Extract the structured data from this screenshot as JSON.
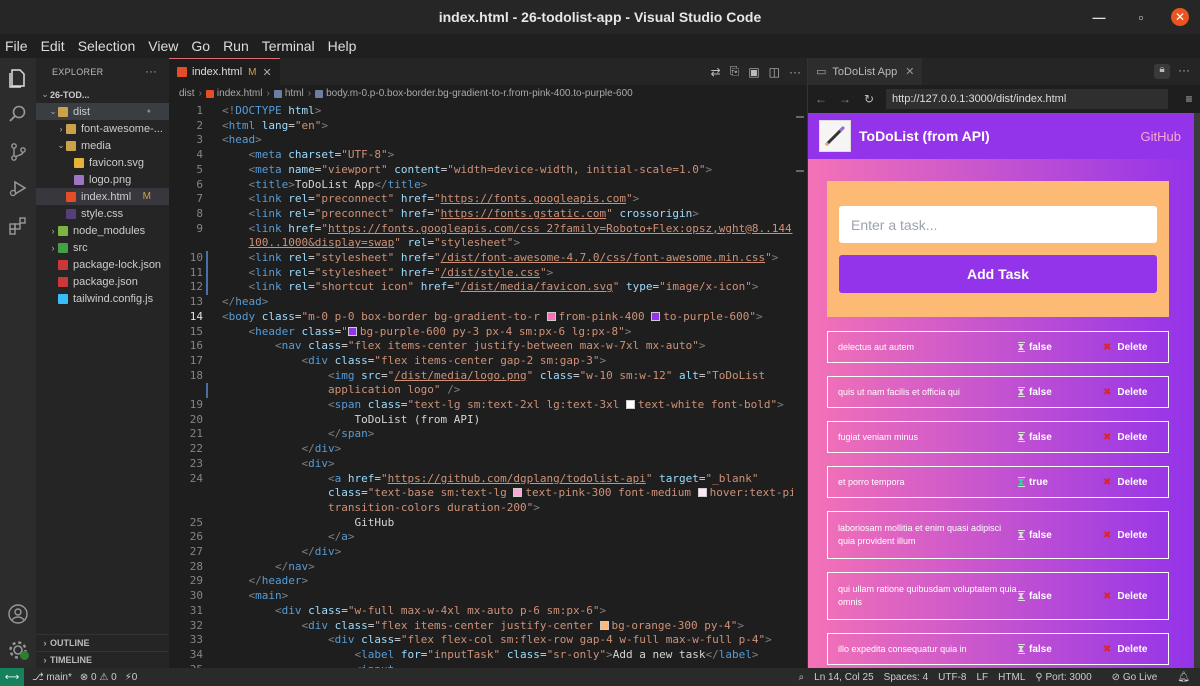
{
  "window": {
    "title": "index.html - 26-todolist-app - Visual Studio Code"
  },
  "menu": [
    "File",
    "Edit",
    "Selection",
    "View",
    "Go",
    "Run",
    "Terminal",
    "Help"
  ],
  "explorer": {
    "header": "EXPLORER",
    "tree": [
      {
        "label": "26-TOD...",
        "indent": 0,
        "chev": "⌄",
        "bold": true
      },
      {
        "label": "dist",
        "indent": 1,
        "chev": "⌄",
        "icon": "#c9a24a",
        "dot": "●",
        "open": true
      },
      {
        "label": "font-awesome-...",
        "indent": 2,
        "chev": "›",
        "icon": "#c9a24a"
      },
      {
        "label": "media",
        "indent": 2,
        "chev": "⌄",
        "icon": "#c9a24a"
      },
      {
        "label": "favicon.svg",
        "indent": 3,
        "icon": "#e8b339"
      },
      {
        "label": "logo.png",
        "indent": 3,
        "icon": "#a074c4"
      },
      {
        "label": "index.html",
        "indent": 2,
        "icon": "#e44d26",
        "badge": "M",
        "selected": true
      },
      {
        "label": "style.css",
        "indent": 2,
        "icon": "#563d7c"
      },
      {
        "label": "node_modules",
        "indent": 1,
        "chev": "›",
        "icon": "#7cb342"
      },
      {
        "label": "src",
        "indent": 1,
        "chev": "›",
        "icon": "#43a047"
      },
      {
        "label": "package-lock.json",
        "indent": 1,
        "icon": "#cb3837"
      },
      {
        "label": "package.json",
        "indent": 1,
        "icon": "#cb3837"
      },
      {
        "label": "tailwind.config.js",
        "indent": 1,
        "icon": "#38bdf8"
      }
    ],
    "outline": "OUTLINE",
    "timeline": "TIMELINE"
  },
  "editor": {
    "tab": {
      "label": "index.html",
      "badge": "M"
    },
    "breadcrumb": [
      "dist",
      "index.html",
      "html",
      "body.m-0.p-0.box-border.bg-gradient-to-r.from-pink-400.to-purple-600"
    ],
    "lines": [
      {
        "n": "1",
        "h": "<span class='p'>&lt;!</span><span class='t'>DOCTYPE</span> <span class='a'>html</span><span class='p'>&gt;</span>"
      },
      {
        "n": "2",
        "h": "<span class='p'>&lt;</span><span class='t'>html</span> <span class='a'>lang</span>=<span class='s'>\"en\"</span><span class='p'>&gt;</span>"
      },
      {
        "n": "3",
        "h": "<span class='p'>&lt;</span><span class='t'>head</span><span class='p'>&gt;</span>"
      },
      {
        "n": "4",
        "h": "    <span class='p'>&lt;</span><span class='t'>meta</span> <span class='a'>charset</span>=<span class='s'>\"UTF-8\"</span><span class='p'>&gt;</span>"
      },
      {
        "n": "5",
        "h": "    <span class='p'>&lt;</span><span class='t'>meta</span> <span class='a'>name</span>=<span class='s'>\"viewport\"</span> <span class='a'>content</span>=<span class='s'>\"width=device-width, initial-scale=1.0\"</span><span class='p'>&gt;</span>"
      },
      {
        "n": "6",
        "h": "    <span class='p'>&lt;</span><span class='t'>title</span><span class='p'>&gt;</span>ToDoList App<span class='p'>&lt;/</span><span class='t'>title</span><span class='p'>&gt;</span>"
      },
      {
        "n": "7",
        "h": "    <span class='p'>&lt;</span><span class='t'>link</span> <span class='a'>rel</span>=<span class='s'>\"preconnect\"</span> <span class='a'>href</span>=<span class='s'>\"<span class='u'>https://fonts.googleapis.com</span>\"</span><span class='p'>&gt;</span>"
      },
      {
        "n": "8",
        "h": "    <span class='p'>&lt;</span><span class='t'>link</span> <span class='a'>rel</span>=<span class='s'>\"preconnect\"</span> <span class='a'>href</span>=<span class='s'>\"<span class='u'>https://fonts.gstatic.com</span>\"</span> <span class='a'>crossorigin</span><span class='p'>&gt;</span>"
      },
      {
        "n": "9",
        "h": "    <span class='p'>&lt;</span><span class='t'>link</span> <span class='a'>href</span>=<span class='s'>\"<span class='u'>https://fonts.googleapis.com/css 2?family=Roboto+Flex:opsz,wght@8..144,</span></span>"
      },
      {
        "n": "",
        "h": "    <span class='s'><span class='u'>100..1000&amp;display=swap</span>\"</span> <span class='a'>rel</span>=<span class='s'>\"stylesheet\"</span><span class='p'>&gt;</span>"
      },
      {
        "n": "10",
        "h": "    <span class='p'>&lt;</span><span class='t'>link</span> <span class='a'>rel</span>=<span class='s'>\"stylesheet\"</span> <span class='a'>href</span>=<span class='s'>\"<span class='u'>/dist/font-awesome-4.7.0/css/font-awesome.min.css</span>\"</span><span class='p'>&gt;</span>"
      },
      {
        "n": "11",
        "h": "    <span class='p'>&lt;</span><span class='t'>link</span> <span class='a'>rel</span>=<span class='s'>\"stylesheet\"</span> <span class='a'>href</span>=<span class='s'>\"<span class='u'>/dist/style.css</span>\"</span><span class='p'>&gt;</span>"
      },
      {
        "n": "12",
        "h": "    <span class='p'>&lt;</span><span class='t'>link</span> <span class='a'>rel</span>=<span class='s'>\"shortcut icon\"</span> <span class='a'>href</span>=<span class='s'>\"<span class='u'>/dist/media/favicon.svg</span>\"</span> <span class='a'>type</span>=<span class='s'>\"image/x-icon\"</span><span class='p'>&gt;</span>"
      },
      {
        "n": "13",
        "h": "<span class='p'>&lt;/</span><span class='t'>head</span><span class='p'>&gt;</span>"
      },
      {
        "n": "14",
        "h": "<span class='p'>&lt;</span><span class='t'>body</span> <span class='a'>class</span>=<span class='s'>\"m-0 p-0 box-border bg-gradient-to-r <span class='sw' style='background:#f472b6'></span>from-pink-400 <span class='sw' style='background:#9333ea'></span>to-purple-600\"</span><span class='p'>&gt;</span>",
        "cur": true
      },
      {
        "n": "15",
        "h": "    <span class='p'>&lt;</span><span class='t'>header</span> <span class='a'>class</span>=<span class='s'>\"<span class='sw' style='background:#9333ea'></span>bg-purple-600 py-3 px-4 sm:px-6 lg:px-8\"</span><span class='p'>&gt;</span>"
      },
      {
        "n": "16",
        "h": "        <span class='p'>&lt;</span><span class='t'>nav</span> <span class='a'>class</span>=<span class='s'>\"flex items-center justify-between max-w-7xl mx-auto\"</span><span class='p'>&gt;</span>"
      },
      {
        "n": "17",
        "h": "            <span class='p'>&lt;</span><span class='t'>div</span> <span class='a'>class</span>=<span class='s'>\"flex items-center gap-2 sm:gap-3\"</span><span class='p'>&gt;</span>"
      },
      {
        "n": "18",
        "h": "                <span class='p'>&lt;</span><span class='t'>img</span> <span class='a'>src</span>=<span class='s'>\"<span class='u'>/dist/media/logo.png</span>\"</span> <span class='a'>class</span>=<span class='s'>\"w-10 sm:w-12\"</span> <span class='a'>alt</span>=<span class='s'>\"ToDoList</span>"
      },
      {
        "n": "",
        "h": "                <span class='s'>application logo\"</span> <span class='p'>/&gt;</span>"
      },
      {
        "n": "19",
        "h": "                <span class='p'>&lt;</span><span class='t'>span</span> <span class='a'>class</span>=<span class='s'>\"text-lg sm:text-2xl lg:text-3xl <span class='sw' style='background:#ffffff'></span>text-white font-bold\"</span><span class='p'>&gt;</span>"
      },
      {
        "n": "20",
        "h": "                    ToDoList (from API)"
      },
      {
        "n": "21",
        "h": "                <span class='p'>&lt;/</span><span class='t'>span</span><span class='p'>&gt;</span>"
      },
      {
        "n": "22",
        "h": "            <span class='p'>&lt;/</span><span class='t'>div</span><span class='p'>&gt;</span>"
      },
      {
        "n": "23",
        "h": "            <span class='p'>&lt;</span><span class='t'>div</span><span class='p'>&gt;</span>"
      },
      {
        "n": "24",
        "h": "                <span class='p'>&lt;</span><span class='t'>a</span> <span class='a'>href</span>=<span class='s'>\"<span class='u'>https://github.com/dgplang/todolist-api</span>\"</span> <span class='a'>target</span>=<span class='s'>\"_blank\"</span>"
      },
      {
        "n": "",
        "h": "                <span class='a'>class</span>=<span class='s'>\"text-base sm:text-lg <span class='sw' style='background:#f9a8d4'></span>text-pink-300 font-medium <span class='sw' style='background:#fce7f3'></span>hover:text-pink-200</span>"
      },
      {
        "n": "",
        "h": "                <span class='s'>transition-colors duration-200\"</span><span class='p'>&gt;</span>"
      },
      {
        "n": "25",
        "h": "                    GitHub"
      },
      {
        "n": "26",
        "h": "                <span class='p'>&lt;/</span><span class='t'>a</span><span class='p'>&gt;</span>"
      },
      {
        "n": "27",
        "h": "            <span class='p'>&lt;/</span><span class='t'>div</span><span class='p'>&gt;</span>"
      },
      {
        "n": "28",
        "h": "        <span class='p'>&lt;/</span><span class='t'>nav</span><span class='p'>&gt;</span>"
      },
      {
        "n": "29",
        "h": "    <span class='p'>&lt;/</span><span class='t'>header</span><span class='p'>&gt;</span>"
      },
      {
        "n": "30",
        "h": "    <span class='p'>&lt;</span><span class='t'>main</span><span class='p'>&gt;</span>"
      },
      {
        "n": "31",
        "h": "        <span class='p'>&lt;</span><span class='t'>div</span> <span class='a'>class</span>=<span class='s'>\"w-full max-w-4xl mx-auto p-6 sm:px-6\"</span><span class='p'>&gt;</span>"
      },
      {
        "n": "32",
        "h": "            <span class='p'>&lt;</span><span class='t'>div</span> <span class='a'>class</span>=<span class='s'>\"flex items-center justify-center <span class='sw' style='background:#fdba74'></span>bg-orange-300 py-4\"</span><span class='p'>&gt;</span>"
      },
      {
        "n": "33",
        "h": "                <span class='p'>&lt;</span><span class='t'>div</span> <span class='a'>class</span>=<span class='s'>\"flex flex-col sm:flex-row gap-4 w-full max-w-full p-4\"</span><span class='p'>&gt;</span>"
      },
      {
        "n": "34",
        "h": "                    <span class='p'>&lt;</span><span class='t'>label</span> <span class='a'>for</span>=<span class='s'>\"inputTask\"</span> <span class='a'>class</span>=<span class='s'>\"sr-only\"</span><span class='p'>&gt;</span>Add a new task<span class='p'>&lt;/</span><span class='t'>label</span><span class='p'>&gt;</span>"
      },
      {
        "n": "35",
        "h": "                    <span class='p'>&lt;</span><span class='t'>input</span>"
      }
    ]
  },
  "preview": {
    "tab": "ToDoList App",
    "url": "http://127.0.0.1:3000/dist/index.html",
    "app_title": "ToDoList (from API)",
    "github": "GitHub",
    "input_placeholder": "Enter a task...",
    "add_button": "Add Task",
    "tasks": [
      {
        "title": "delectus aut autem",
        "status": "false",
        "done": false,
        "delete": "Delete"
      },
      {
        "title": "quis ut nam facilis et officia qui",
        "status": "false",
        "done": false,
        "delete": "Delete"
      },
      {
        "title": "fugiat veniam minus",
        "status": "false",
        "done": false,
        "delete": "Delete"
      },
      {
        "title": "et porro tempora",
        "status": "true",
        "done": true,
        "delete": "Delete"
      },
      {
        "title": "laboriosam mollitia et enim quasi adipisci quia provident illum",
        "status": "false",
        "done": false,
        "delete": "Delete"
      },
      {
        "title": "qui ullam ratione quibusdam voluptatem quia omnis",
        "status": "false",
        "done": false,
        "delete": "Delete"
      },
      {
        "title": "illo expedita consequatur quia in",
        "status": "false",
        "done": false,
        "delete": "Delete"
      }
    ]
  },
  "statusbar": {
    "branch": "main*",
    "errors": "⊗ 0 ⚠ 0",
    "ports": "⚡0",
    "position": "Ln 14, Col 25",
    "spaces": "Spaces: 4",
    "encoding": "UTF-8",
    "eol": "LF",
    "language": "HTML",
    "port": "Port: 3000",
    "golive": "Go Live"
  }
}
